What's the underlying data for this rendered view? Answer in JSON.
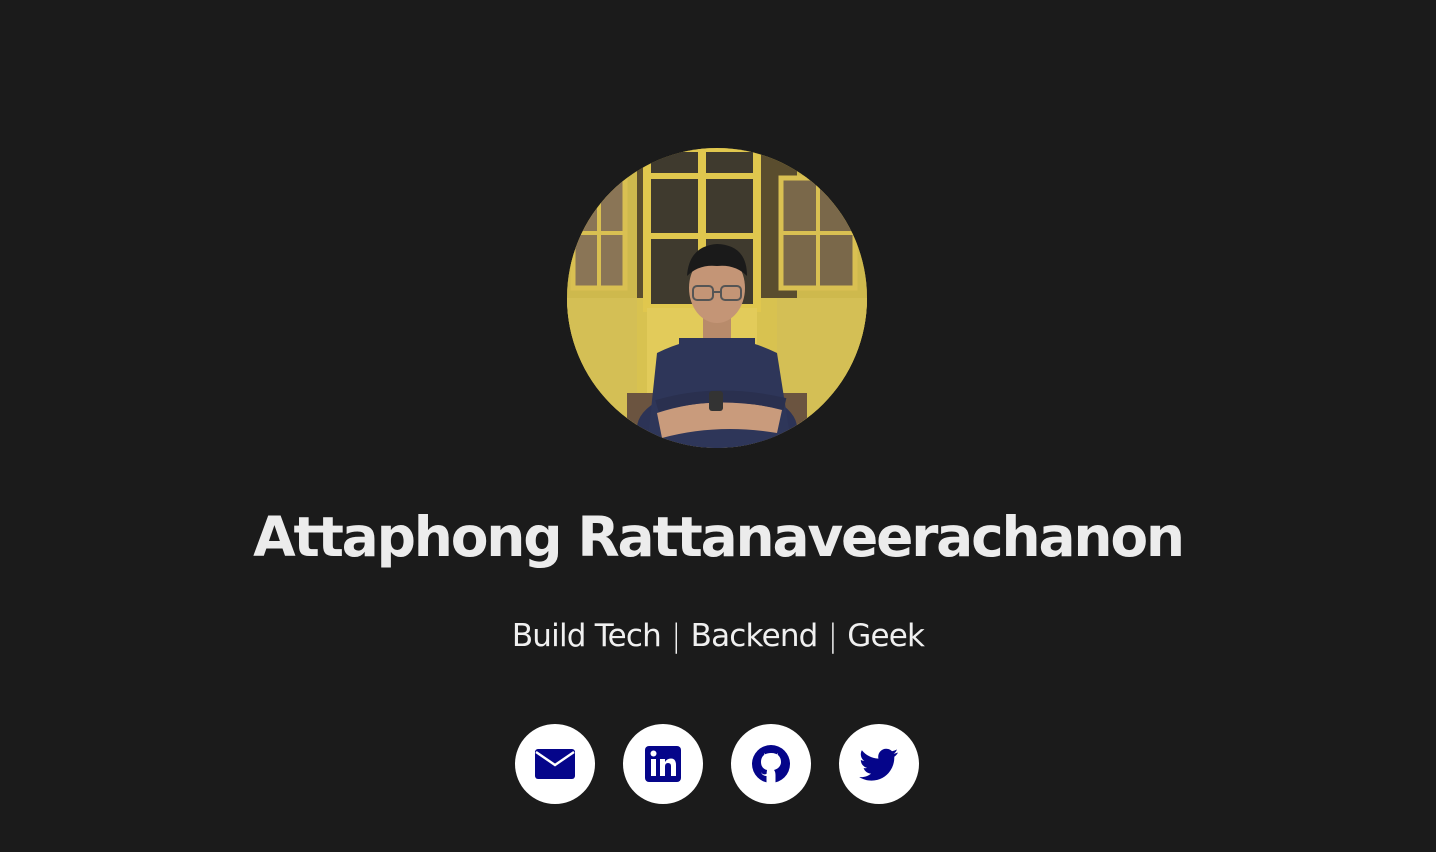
{
  "profile": {
    "name": "Attaphong Rattanaveerachanon",
    "tagline_parts": [
      "Build Tech",
      "Backend",
      "Geek"
    ],
    "separator": "|"
  },
  "socials": [
    {
      "icon": "envelope-icon",
      "label": "email"
    },
    {
      "icon": "linkedin-icon",
      "label": "linkedin"
    },
    {
      "icon": "github-icon",
      "label": "github"
    },
    {
      "icon": "twitter-icon",
      "label": "twitter"
    }
  ],
  "colors": {
    "background": "#1b1b1b",
    "text": "#ececec",
    "icon_bg": "#ffffff",
    "icon_fg": "#05058a"
  }
}
